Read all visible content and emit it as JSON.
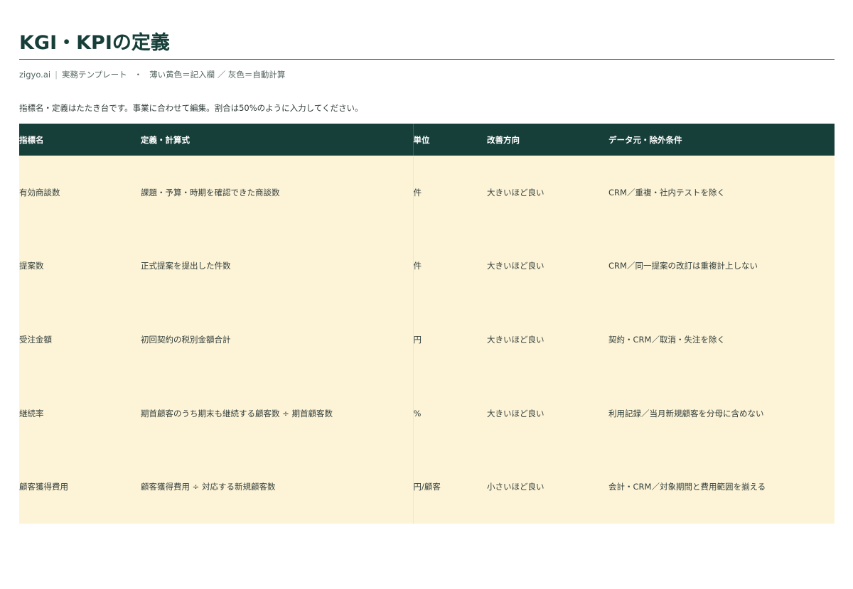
{
  "title": "KGI・KPIの定義",
  "meta": {
    "brand": "zigyo.ai",
    "separator": "|",
    "template_label": "実務テンプレート",
    "dot": "・",
    "legend": "薄い黄色＝記入欄 ／ 灰色＝自動計算"
  },
  "note": "指標名・定義はたたき台です。事業に合わせて編集。割合は50%のように入力してください。",
  "table": {
    "headers": [
      "指標名",
      "定義・計算式",
      "単位",
      "改善方向",
      "データ元・除外条件"
    ],
    "rows": [
      [
        "有効商談数",
        "課題・予算・時期を確認できた商談数",
        "件",
        "大きいほど良い",
        "CRM／重複・社内テストを除く"
      ],
      [
        "提案数",
        "正式提案を提出した件数",
        "件",
        "大きいほど良い",
        "CRM／同一提案の改訂は重複計上しない"
      ],
      [
        "受注金額",
        "初回契約の税別金額合計",
        "円",
        "大きいほど良い",
        "契約・CRM／取消・失注を除く"
      ],
      [
        "継続率",
        "期首顧客のうち期末も継続する顧客数 ÷ 期首顧客数",
        "%",
        "大きいほど良い",
        "利用記録／当月新規顧客を分母に含めない"
      ],
      [
        "顧客獲得費用",
        "顧客獲得費用 ÷ 対応する新規顧客数",
        "円/顧客",
        "小さいほど良い",
        "会計・CRM／対象期間と費用範囲を揃える"
      ]
    ]
  },
  "colors": {
    "header_bg": "#173f3a",
    "input_bg": "#fdf3d6",
    "title": "#173f3a"
  }
}
